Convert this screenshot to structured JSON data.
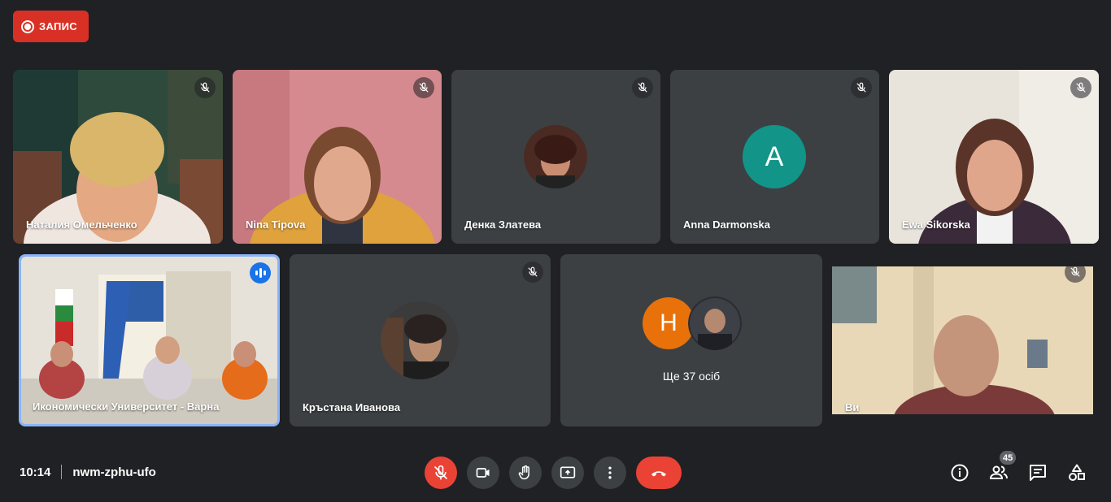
{
  "recording": {
    "label": "ЗАПИС"
  },
  "participants": {
    "p1": {
      "name": "Наталия Омельченко"
    },
    "p2": {
      "name": "Nina Tipova"
    },
    "p3": {
      "name": "Денка Златева"
    },
    "p4": {
      "name": "Anna Darmonska",
      "initial": "A",
      "avatar_color": "#129488"
    },
    "p5": {
      "name": "Ewa Sikorska"
    },
    "p6": {
      "name": "Икономически Университет - Варна"
    },
    "p7": {
      "name": "Кръстана Иванова"
    },
    "p8": {
      "more_label": "Ще 37 осіб",
      "initial": "Н",
      "avatar_color": "#e8710a"
    },
    "p9": {
      "name": "Ви"
    }
  },
  "meeting": {
    "time": "10:14",
    "code": "nwm-zphu-ufo"
  },
  "toolbar": {
    "participant_count": "45",
    "icons": [
      "mic-off-icon",
      "camera-icon",
      "raise-hand-icon",
      "present-screen-icon",
      "more-options-icon",
      "end-call-icon",
      "info-icon",
      "people-icon",
      "chat-icon",
      "activities-icon"
    ]
  },
  "colors": {
    "background": "#202124",
    "tile": "#3c4043",
    "danger": "#ea4335",
    "accent": "#1a73e8"
  }
}
